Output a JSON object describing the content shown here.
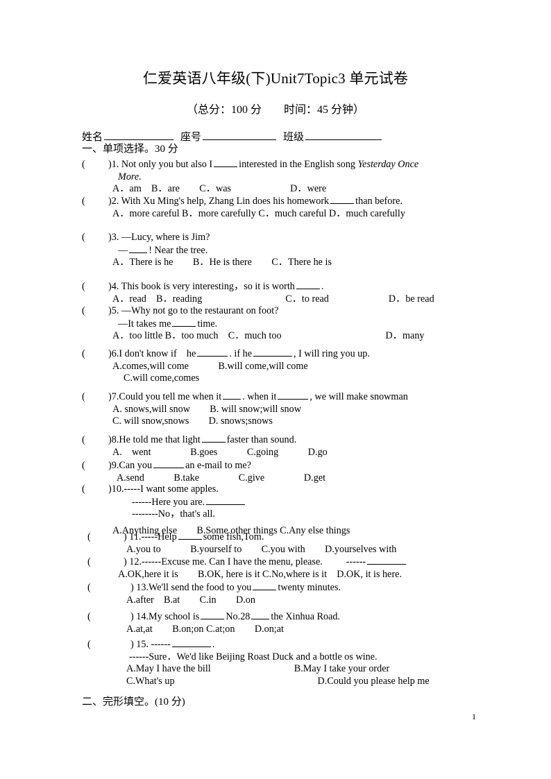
{
  "document": {
    "title": "仁爱英语八年级(下)Unit7Topic3 单元试卷",
    "subtitle": "（总分：100 分　　时间：45 分钟）",
    "page_number": "1"
  },
  "fields": {
    "name_label": "姓名",
    "seat_label": "座号",
    "class_label": "班级"
  },
  "sections": {
    "one": "一、单项选择。30 分",
    "two": "二、完形填空。(10 分)"
  },
  "questions": [
    {
      "num": "1",
      "stem_pre": ")1. Not only you but also I",
      "stem_post": "interested in the English song",
      "italic_title": "Yesterday Once",
      "cont": "More.",
      "options": "A．am　B．are　　C．was　　　　　　D．were"
    },
    {
      "num": "2",
      "stem_pre": ")2. With Xu Ming's help, Zhang Lin does his homework",
      "stem_post": "than before.",
      "options": "A．more careful B．more carefully C．much careful D．much carefully"
    },
    {
      "num": "3",
      "stem_pre": ")3. —Lucy, where is Jim?",
      "cont_pre": "—",
      "cont_post": "! Near the tree.",
      "options": "A．There is he　　B．He is there　　C．There he is"
    },
    {
      "num": "4",
      "stem_pre": ")4. This book is very interesting，so it is worth",
      "stem_post": ".",
      "options": "A．read　B．reading",
      "options_c": "C．to read",
      "options_d": "D．be read"
    },
    {
      "num": "5",
      "stem_pre": ")5. —Why not go to the restaurant on foot?",
      "cont_pre": "—It takes me",
      "cont_post": "time.",
      "options": "A．too little B．too much　C．much too",
      "options_d": "D．many"
    },
    {
      "num": "6",
      "stem_pre": ")6.I don't know if　he",
      "stem_mid": ". if he",
      "stem_post": ", I will ring you up.",
      "options": "A.comes,will come　　　B.will come,will come",
      "options2": "C.will come,comes"
    },
    {
      "num": "7",
      "stem_pre": ")7.Could you tell me when it",
      "stem_mid": ". when it",
      "stem_post": ", we will make snowman",
      "options": "A. snows,will snow　　B. will snow;will snow",
      "options2": "C. will snow,snows　　D. snows;snows"
    },
    {
      "num": "8",
      "stem_pre": ")8.He told me that light",
      "stem_post": "faster than sound.",
      "options": "A.　went　　　　B.goes　　　C.going　　　D.go"
    },
    {
      "num": "9",
      "stem_pre": ")9.Can you",
      "stem_post": "an e-mail to me?",
      "options": "A.send　　　B.take　　　　C.give　　　　D.get"
    },
    {
      "num": "10",
      "stem_pre": ")10.-----I want some apples.",
      "cont_pre": "------Here you are.",
      "cont2": "--------No，that's all.",
      "options": "A.Anything else　　B.Some other things C.Any else things"
    },
    {
      "num": "11",
      "stem_pre": ") 11.-----Help",
      "stem_post": "some fish,Tom.",
      "options": "A.you to　　　B.yourself to　　C.you with　　D.yourselves with"
    },
    {
      "num": "12",
      "stem_pre": ") 12.------Excuse me. Can I have the menu, please.",
      "stem_post": "------",
      "options": "A.OK,here it is　　B.OK, here is it C.No,where is it　D.OK, it is here."
    },
    {
      "num": "13",
      "stem_pre": ") 13.We'll send the food to you",
      "stem_post": "twenty minutes.",
      "options": "A.after　B.at　　C.in　　D.on"
    },
    {
      "num": "14",
      "stem_pre": ") 14.My school is",
      "stem_mid": "No.28",
      "stem_post": "the Xinhua Road.",
      "options": "A.at,at　　B.on;on C.at;on　　D.on;at"
    },
    {
      "num": "15",
      "stem_pre": ") 15. ------",
      "stem_post": ".",
      "cont_pre": "------Sure．We'd like Beijing Roast Duck and a bottle os wine.",
      "options": "A.May I have the bill",
      "options_b": "B.May I take your order",
      "options_c": "C.What's up",
      "options_d": "D.Could you please help me"
    }
  ]
}
